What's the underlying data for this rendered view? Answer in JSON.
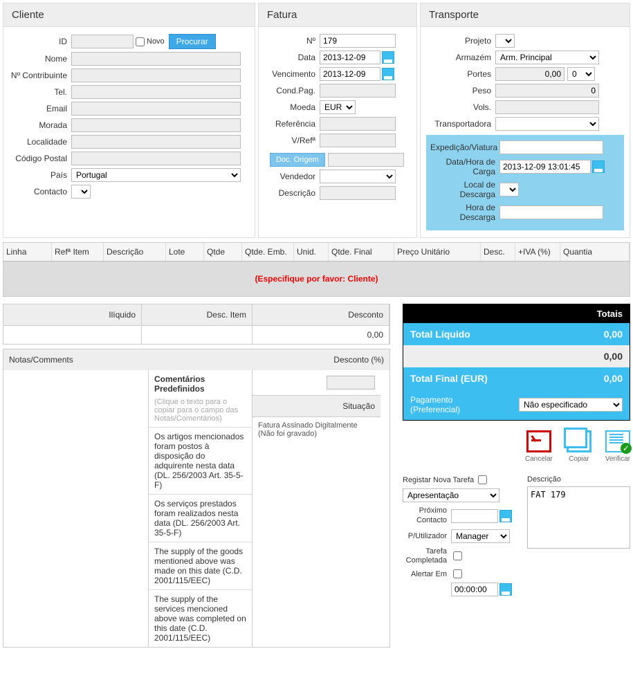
{
  "cliente": {
    "title": "Cliente",
    "id_label": "ID",
    "id": "",
    "novo_label": "Novo",
    "procurar_label": "Procurar",
    "nome_label": "Nome",
    "nome": "",
    "contribuinte_label": "Nº Contribuinte",
    "contribuinte": "",
    "tel_label": "Tel.",
    "tel": "",
    "email_label": "Email",
    "email": "",
    "morada_label": "Morada",
    "morada": "",
    "localidade_label": "Localidade",
    "localidade": "",
    "codpostal_label": "Código Postal",
    "codpostal": "",
    "pais_label": "País",
    "pais": "Portugal",
    "contacto_label": "Contacto"
  },
  "fatura": {
    "title": "Fatura",
    "num_label": "Nº",
    "num": "179",
    "data_label": "Data",
    "data": "2013-12-09",
    "venc_label": "Vencimento",
    "venc": "2013-12-09",
    "condpag_label": "Cond.Pag.",
    "condpag": "",
    "moeda_label": "Moeda",
    "moeda": "EUR",
    "referencia_label": "Referência",
    "referencia": "",
    "vref_label": "V/Refª",
    "vref": "",
    "docorigem_label": "Doc. Origem",
    "docorigem": "",
    "vendedor_label": "Vendedor",
    "vendedor": "",
    "descricao_label": "Descrição",
    "descricao": ""
  },
  "transporte": {
    "title": "Transporte",
    "projeto_label": "Projeto",
    "armazem_label": "Armazém",
    "armazem": "Arm. Principal",
    "portes_label": "Portes",
    "portes": "0,00",
    "portes_sel": "0",
    "peso_label": "Peso",
    "peso": "0",
    "vols_label": "Vols.",
    "vols": "",
    "transportadora_label": "Transportadora",
    "expedicao_label": "Expedição/Viatura",
    "expedicao": "",
    "datahora_label": "Data/Hora de Carga",
    "datahora": "2013-12-09 13:01:45",
    "localdesc_label": "Local de Descarga",
    "horadesc_label": "Hora de Descarga",
    "horadesc": ""
  },
  "grid": {
    "cols": {
      "linha": "Linha",
      "refitem": "Refª Item",
      "descricao": "Descrição",
      "lote": "Lote",
      "qtde": "Qtde",
      "qtdeemb": "Qtde. Emb.",
      "unid": "Unid.",
      "qtdefinal": "Qtde. Final",
      "preco": "Preço Unitário",
      "desc": "Desc.",
      "iva": "+IVA (%)",
      "quantia": "Quantia"
    },
    "warning": "(Especifique por favor: Cliente)"
  },
  "summary": {
    "iliquido_label": "Ilíquido",
    "iliquido": "",
    "descitem_label": "Desc. Item",
    "descitem": "",
    "desconto_label": "Desconto",
    "desconto": "0,00",
    "notas_label": "Notas/Comments",
    "descpct_label": "Desconto (%)",
    "descpct": "",
    "situacao_label": "Situação",
    "situacao_text": "Fatura Assinado Digitalmente (Não foi gravado)",
    "predef_title": "Comentários Predefinidos",
    "predef_hint": "(Clique o texto para o copiar para o campo das Notas/Comentários)",
    "predef_items": [
      "Os artigos mencionados foram postos à disposição do adquirente nesta data (DL. 256/2003 Art. 35-5-F)",
      "Os serviços prestados foram realizados nesta data (DL. 256/2003 Art. 35-5-F)",
      "The supply of the goods mentioned above was made on this date (C.D. 2001/115/EEC)",
      "The supply of the services mencioned above was completed on this date (C.D. 2001/115/EEC)"
    ]
  },
  "totals": {
    "title": "Totais",
    "liquido_label": "Total Líquido",
    "liquido": "0,00",
    "sub": "0,00",
    "final_label": "Total Final (EUR)",
    "final": "0,00",
    "pagamento_label": "Pagamento (Preferencial)",
    "pagamento": "Não especificado"
  },
  "actions": {
    "cancelar": "Cancelar",
    "copiar": "Copiar",
    "verificar": "Verificar"
  },
  "task": {
    "registar_label": "Registar Nova Tarefa",
    "tipo": "Apresentação",
    "proximo_label": "Próximo Contacto",
    "proximo": "",
    "user_label": "P/Utilizador",
    "user": "Manager",
    "completada_label": "Tarefa Completada",
    "alertar_label": "Alertar Em",
    "alertar_time": "00:00:00",
    "descricao_label": "Descrição",
    "descricao": "FAT 179"
  }
}
